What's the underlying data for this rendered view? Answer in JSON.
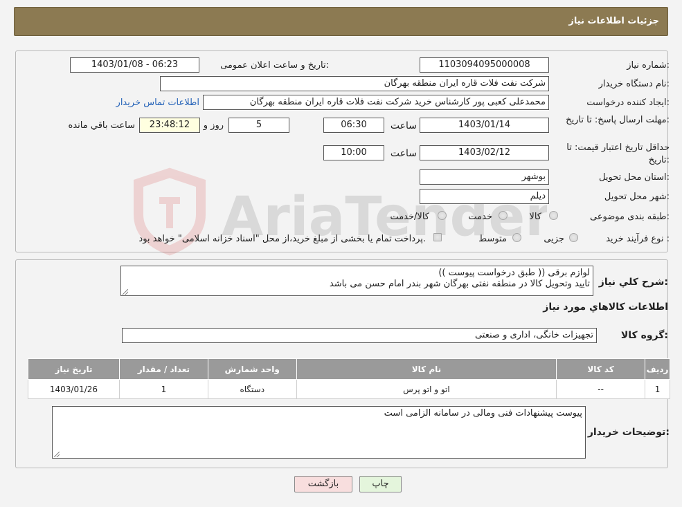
{
  "header": {
    "title": "جزئیات اطلاعات نیاز"
  },
  "form": {
    "need_number_label": "شماره نیاز:",
    "need_number": "1103094095000008",
    "announce_label": "تاریخ و ساعت اعلان عمومی:",
    "announce_value": "1403/01/08 - 06:23",
    "buyer_org_label": "نام دستگاه خریدار:",
    "buyer_org": "شرکت نفت فلات قاره ایران منطقه بهرگان",
    "creator_label": "ایجاد کننده درخواست:",
    "creator": "محمدعلی کعبی پور کارشناس خرید شرکت نفت فلات قاره ایران منطقه بهرگان",
    "contact_link": "اطلاعات تماس خریدار",
    "reply_deadline_label": "مهلت ارسال پاسخ: تا تاریخ:",
    "reply_date": "1403/01/14",
    "time_label": "ساعت",
    "reply_time": "06:30",
    "days_value": "5",
    "days_label": "روز و",
    "remaining_time": "23:48:12",
    "remaining_label": "ساعت باقي مانده",
    "price_validity_label": "حداقل تاریخ اعتبار قیمت: تا تاریخ:",
    "price_date": "1403/02/12",
    "price_time": "10:00",
    "province_label": "استان محل تحویل:",
    "province": "بوشهر",
    "city_label": "شهر محل تحویل:",
    "city": "دیلم",
    "category_label": "طبقه بندی موضوعی:",
    "category_options": [
      "کالا",
      "خدمت",
      "کالا/خدمت"
    ],
    "process_label": "نوع فرآیند خرید :",
    "process_options": [
      "جزیی",
      "متوسط"
    ],
    "process_note": "پرداخت تمام یا بخشی از مبلغ خرید،از محل \"اسناد خزانه اسلامی\" خواهد بود."
  },
  "details": {
    "description_label": "شرح كلي نياز:",
    "description_line1": "لوازم برقی (( طبق درخواست پیوست ))",
    "description_line2": "تایید وتحویل کالا در منطقه نفتی بهرگان شهر بندر امام حسن می باشد",
    "goods_info_title": "اطلاعات كالاهاي مورد نياز",
    "goods_group_label": "گروه کالا:",
    "goods_group": "تجهیزات خانگی، اداری و صنعتی",
    "table": {
      "headers": [
        "رديف",
        "كد كالا",
        "نام كالا",
        "واحد شمارش",
        "تعداد / مقدار",
        "تاريخ نياز"
      ],
      "rows": [
        [
          "1",
          "--",
          "اتو و اتو پرس",
          "دستگاه",
          "1",
          "1403/01/26"
        ]
      ]
    },
    "buyer_notes_label": "توضیحات خریدار:",
    "buyer_notes": "پیوست پیشنهادات فنی ومالی در سامانه الزامی است"
  },
  "buttons": {
    "print": "چاپ",
    "back": "بازگشت"
  },
  "colors": {
    "header_bg": "#8c7a52",
    "link": "#2563b8",
    "back_btn": "#f8dede",
    "print_btn": "#e4f5dc"
  }
}
